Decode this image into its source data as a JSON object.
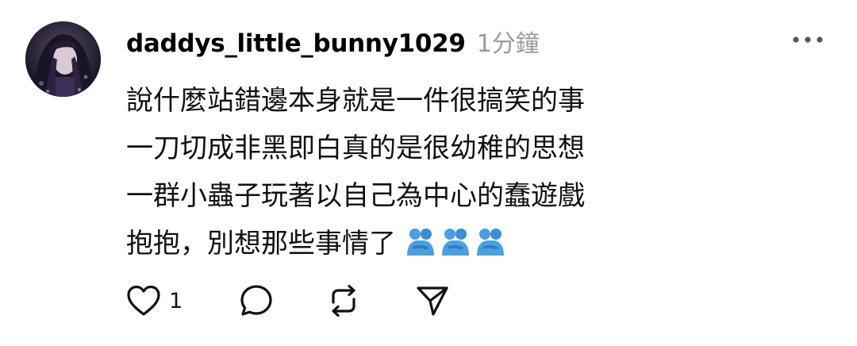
{
  "post": {
    "username": "daddys_little_bunny1029",
    "timestamp": "1分鐘",
    "body_lines": [
      "說什麼站錯邊本身就是一件很搞笑的事",
      "一刀切成非黑即白真的是很幼稚的思想",
      "一群小蟲子玩著以自己為中心的蠢遊戲",
      "抱抱，別想那些事情了"
    ],
    "emoji": [
      "people-hugging",
      "people-hugging",
      "people-hugging"
    ],
    "like_count": "1"
  },
  "icons": {
    "more": "more-dots-icon",
    "like": "heart-icon",
    "reply": "speech-bubble-icon",
    "repost": "repost-icon",
    "share": "send-icon"
  },
  "colors": {
    "text": "#111111",
    "muted": "#9b9b9b",
    "emoji_blue": "#4a9fe0"
  }
}
